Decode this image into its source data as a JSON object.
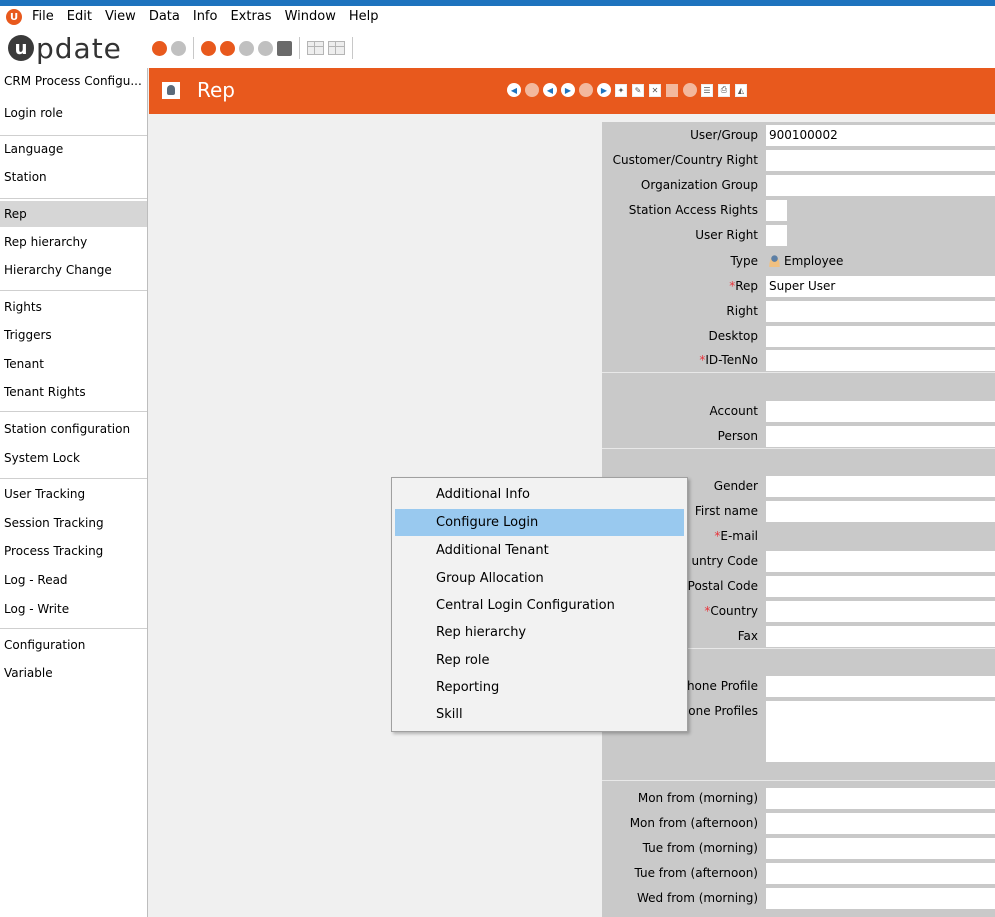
{
  "menubar": {
    "app_icon_glyph": "U",
    "items": [
      "File",
      "Edit",
      "View",
      "Data",
      "Info",
      "Extras",
      "Window",
      "Help"
    ]
  },
  "toolbar": {
    "logo_glyph": "u",
    "logo_text": "pdate"
  },
  "sidebar": {
    "items": [
      "CRM Process Configu...",
      "Login role",
      "Language",
      "Station",
      "Rep",
      "Rep hierarchy",
      "Hierarchy Change",
      "Rights",
      "Triggers",
      "Tenant",
      "Tenant Rights",
      "Station configuration",
      "System Lock",
      "User Tracking",
      "Session Tracking",
      "Process Tracking",
      "Log - Read",
      "Log - Write",
      "Configuration",
      "Variable"
    ],
    "active": "Rep"
  },
  "header": {
    "title": "Rep",
    "accent_color": "#e8591d"
  },
  "form": {
    "rows": [
      {
        "label": "User/Group",
        "value": "900100002"
      },
      {
        "label": "Customer/Country Right",
        "value": ""
      },
      {
        "label": "Organization Group",
        "value": ""
      },
      {
        "label": "Station Access Rights",
        "value": ""
      },
      {
        "label": "User Right",
        "value": ""
      },
      {
        "label": "Type",
        "value": "Employee"
      },
      {
        "label": "Rep",
        "value": "Super User",
        "required": "*"
      },
      {
        "label": "Right",
        "value": ""
      },
      {
        "label": "Desktop",
        "value": ""
      },
      {
        "label": "ID-TenNo",
        "value": "",
        "required": "*"
      },
      {
        "label": "Account",
        "value": ""
      },
      {
        "label": "Person",
        "value": ""
      },
      {
        "label": "Gender",
        "value": ""
      },
      {
        "label": "First name",
        "value": ""
      },
      {
        "label": "E-mail",
        "value": "",
        "required": "*"
      },
      {
        "label": "untry Code",
        "value": ""
      },
      {
        "label": "Postal Code",
        "value": ""
      },
      {
        "label": "Country",
        "value": "",
        "required": "*"
      },
      {
        "label": "Fax",
        "value": ""
      },
      {
        "label": "hone Profile",
        "value": ""
      },
      {
        "label": "one Profiles",
        "value": ""
      },
      {
        "label": "Mon from (morning)",
        "value": ""
      },
      {
        "label": "Mon from (afternoon)",
        "value": ""
      },
      {
        "label": "Tue from (morning)",
        "value": ""
      },
      {
        "label": "Tue from (afternoon)",
        "value": ""
      },
      {
        "label": "Wed from (morning)",
        "value": ""
      }
    ]
  },
  "context_menu": {
    "items": [
      "Additional Info",
      "Configure Login",
      "Additional Tenant",
      "Group Allocation",
      "Central Login Configuration",
      "Rep hierarchy",
      "Rep role",
      "Reporting",
      "Skill"
    ],
    "highlighted": "Configure Login",
    "highlight_color": "#99c9ef"
  }
}
